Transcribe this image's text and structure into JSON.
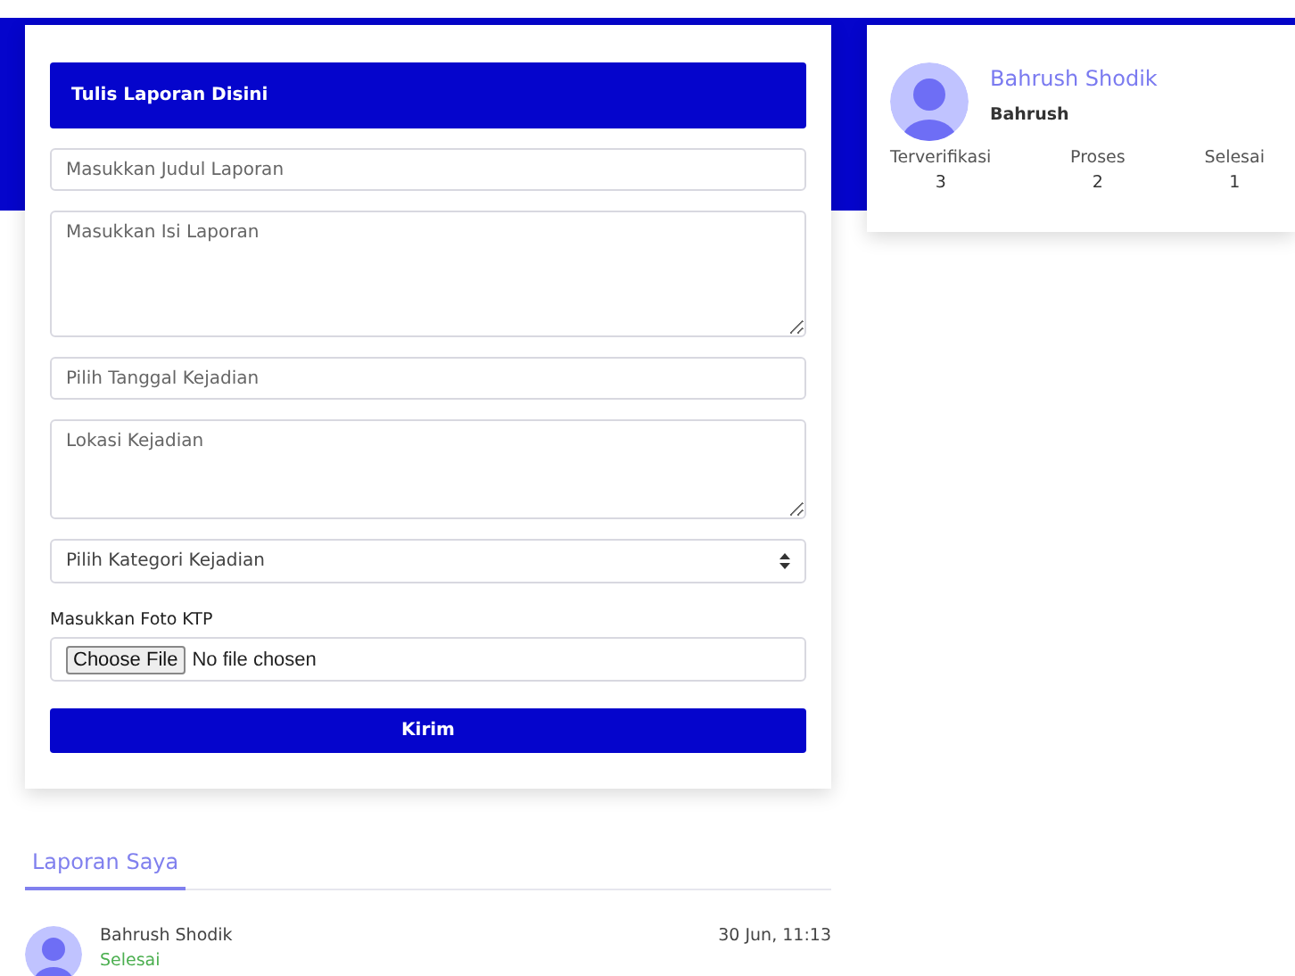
{
  "form": {
    "title": "Tulis Laporan Disini",
    "fields": [
      {
        "kind": "input",
        "placeholder": "Masukkan Judul Laporan"
      },
      {
        "kind": "longtext",
        "placeholder": "Masukkan Isi Laporan"
      },
      {
        "kind": "input",
        "placeholder": "Pilih Tanggal Kejadian"
      },
      {
        "kind": "textarea",
        "placeholder": "Lokasi Kejadian"
      },
      {
        "kind": "select",
        "value": "Pilih Kategori Kejadian"
      },
      {
        "kind": "file",
        "label": "Masukkan Foto KTP",
        "button": "Choose File",
        "status": "No file chosen"
      }
    ],
    "submit": "Kirim"
  },
  "profile": {
    "name": "Bahrush Shodik",
    "username": "Bahrush",
    "stats": [
      {
        "label": "Terverifikasi",
        "value": "3"
      },
      {
        "label": "Proses",
        "value": "2"
      },
      {
        "label": "Selesai",
        "value": "1"
      }
    ]
  },
  "tabs": [
    {
      "label": "Laporan Saya",
      "selected": true
    }
  ],
  "reports": [
    {
      "name": "Bahrush Shodik",
      "status": "Selesai",
      "date": "30 Jun, 11:13"
    }
  ]
}
